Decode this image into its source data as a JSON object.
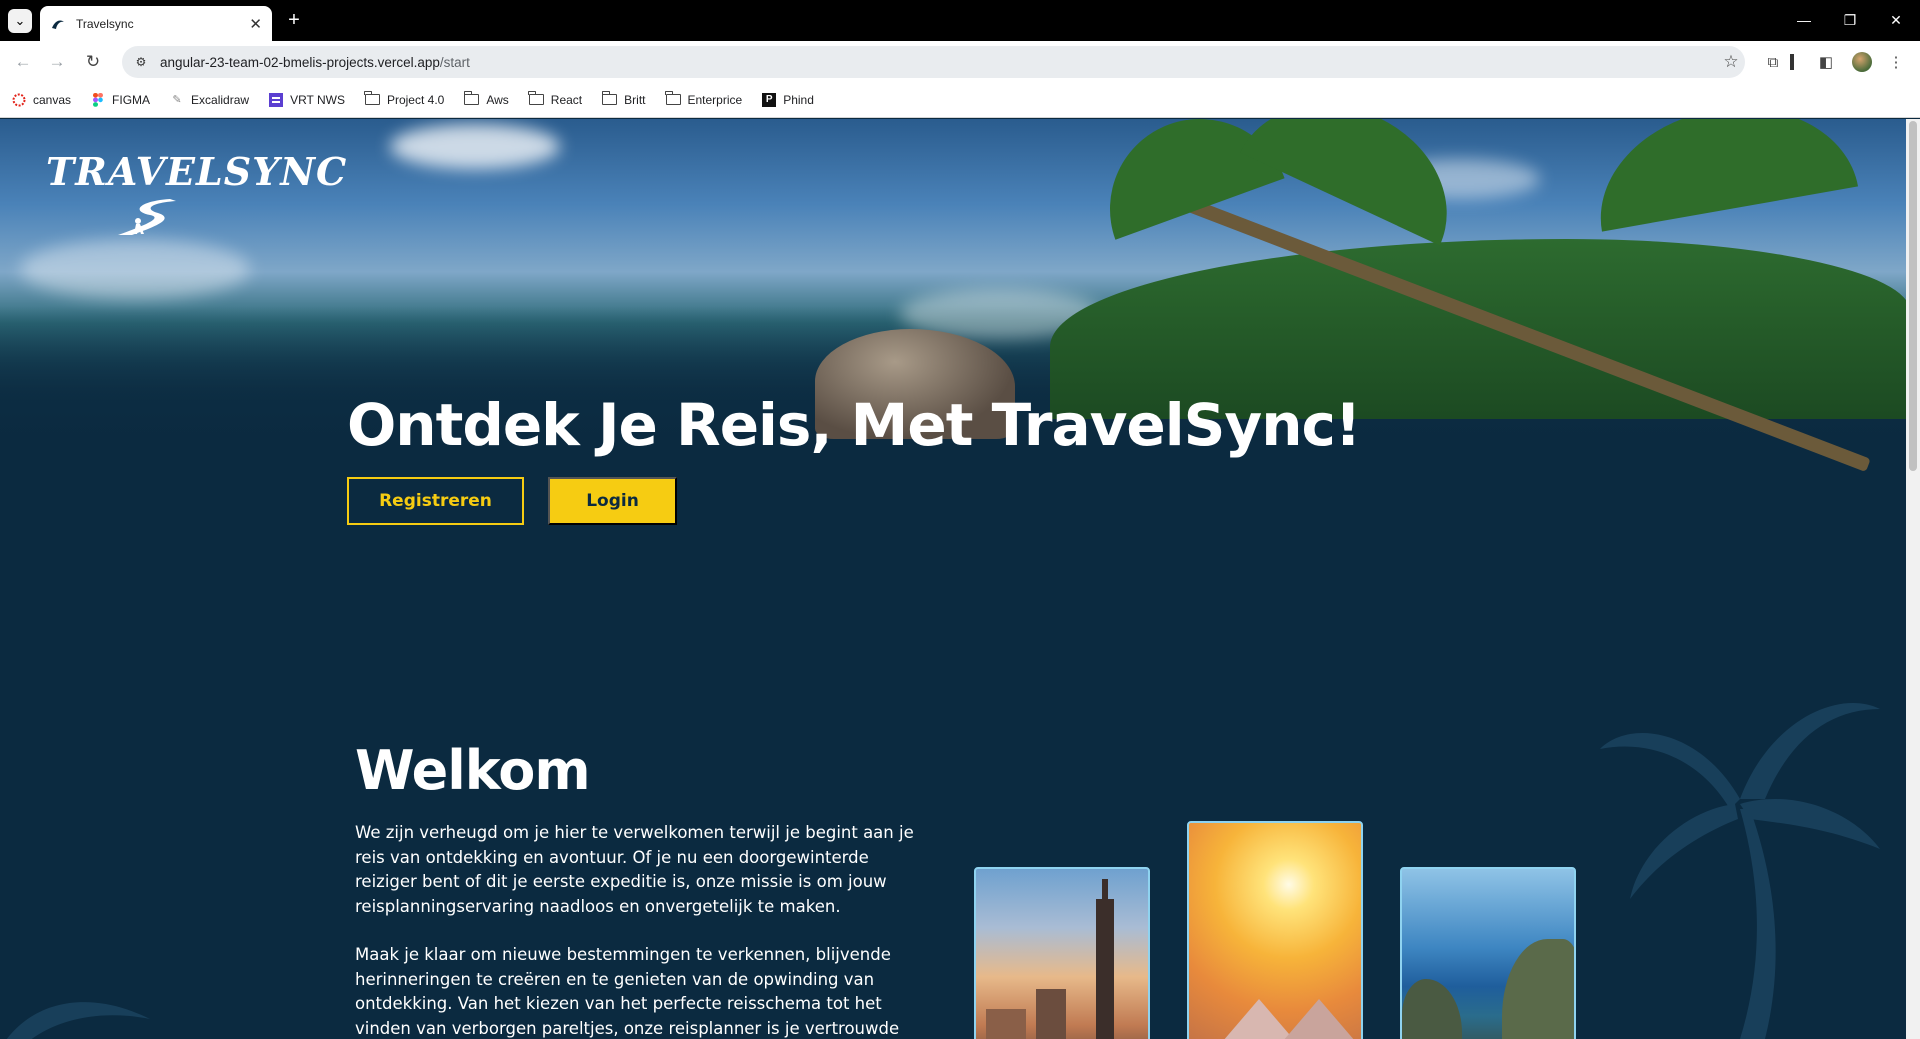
{
  "browser": {
    "tab_title": "Travelsync",
    "url_host": "angular-23-team-02-bmelis-projects.vercel.app",
    "url_path": "/start",
    "bookmarks": [
      {
        "label": "canvas",
        "icon": "canvas-icon"
      },
      {
        "label": "FIGMA",
        "icon": "figma-icon"
      },
      {
        "label": "Excalidraw",
        "icon": "excalidraw-icon"
      },
      {
        "label": "VRT NWS",
        "icon": "vrt-icon"
      },
      {
        "label": "Project 4.0",
        "icon": "folder-icon"
      },
      {
        "label": "Aws",
        "icon": "folder-icon"
      },
      {
        "label": "React",
        "icon": "folder-icon"
      },
      {
        "label": "Britt",
        "icon": "folder-icon"
      },
      {
        "label": "Enterprice",
        "icon": "folder-icon"
      },
      {
        "label": "Phind",
        "icon": "phind-icon"
      }
    ]
  },
  "page": {
    "logo_text": "TRAVELSYNC",
    "hero_title": "Ontdek Je Reis, Met TravelSync!",
    "register_label": "Registreren",
    "login_label": "Login",
    "welcome_title": "Welkom",
    "welcome_paragraph_1": "We zijn verheugd om je hier te verwelkomen terwijl je begint aan je reis van ontdekking en avontuur. Of je nu een doorgewinterde reiziger bent of dit je eerste expeditie is, onze missie is om jouw reisplanningservaring naadloos en onvergetelijk te maken.",
    "welcome_paragraph_2": "Maak je klaar om nieuwe bestemmingen te verkennen, blijvende herinneringen te creëren en te genieten van de opwinding van ontdekking. Van het kiezen van het perfecte reisschema tot het vinden van verborgen pareltjes, onze reisplanner is je vertrouwde"
  },
  "colors": {
    "accent": "#f6cc12",
    "background": "#0b2a40",
    "photo_border": "#8fd3f0"
  }
}
